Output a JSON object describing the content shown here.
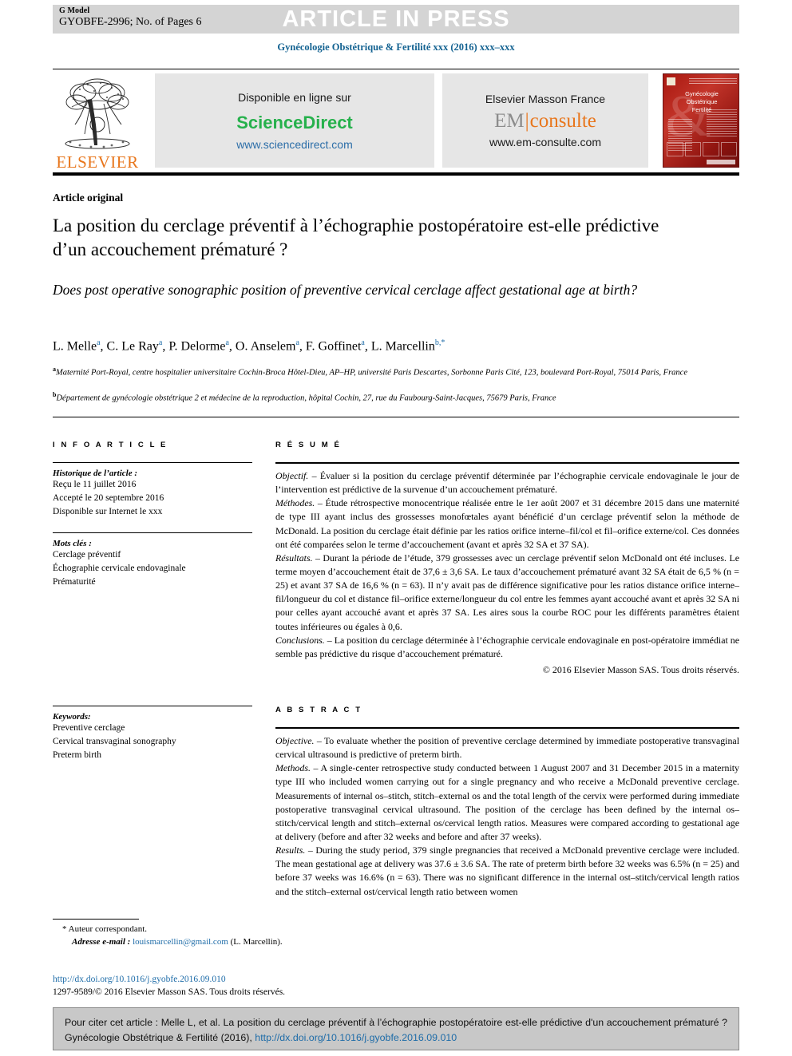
{
  "banner": {
    "g_model": "G Model",
    "pages": "GYOBFE-2996; No. of Pages 6",
    "article_in_press": "ARTICLE IN PRESS"
  },
  "journal": {
    "citation_line": "Gynécologie Obstétrique & Fertilité xxx (2016) xxx–xxx"
  },
  "masthead": {
    "publisher_logo": "ELSEVIER",
    "sciencedirect": {
      "available_label": "Disponible en ligne sur",
      "name": "ScienceDirect",
      "url": "www.sciencedirect.com"
    },
    "emconsulte": {
      "publisher_label": "Elsevier Masson France",
      "logo_em": "EM",
      "logo_consulte": "consulte",
      "url": "www.em-consulte.com"
    },
    "cover": {
      "line1": "Gynécologie",
      "line2": "Obstétrique",
      "line3": "Fertilité"
    }
  },
  "article": {
    "type": "Article original",
    "title_fr": "La position du cerclage préventif à l’échographie postopératoire est-elle prédictive d’un accouchement prématuré ?",
    "title_en": "Does post operative sonographic position of preventive cervical cerclage affect gestational age at birth?",
    "affiliation_a": "Maternité Port-Royal, centre hospitalier universitaire Cochin-Broca Hôtel-Dieu, AP–HP, université Paris Descartes, Sorbonne Paris Cité, 123, boulevard Port-Royal, 75014 Paris, France",
    "affiliation_b": "Département de gynécologie obstétrique 2 et médecine de la reproduction, hôpital Cochin, 27, rue du Faubourg-Saint-Jacques, 75679 Paris, France"
  },
  "authors": [
    {
      "name": "L. Melle",
      "marks": "a"
    },
    {
      "name": "C. Le Ray",
      "marks": "a"
    },
    {
      "name": "P. Delorme",
      "marks": "a"
    },
    {
      "name": "O. Anselem",
      "marks": "a"
    },
    {
      "name": "F. Goffinet",
      "marks": "a"
    },
    {
      "name": "L. Marcellin",
      "marks": "b,*"
    }
  ],
  "info_article": {
    "heading": "I N F O   A R T I C L E",
    "history_label": "Historique de l’article :",
    "history": [
      "Reçu le 11 juillet 2016",
      "Accepté le 20 septembre 2016",
      "Disponible sur Internet le xxx"
    ],
    "keywords_label": "Mots clés :",
    "keywords": [
      "Cerclage préventif",
      "Échographie cervicale endovaginale",
      "Prématurité"
    ]
  },
  "keywords_en": {
    "label": "Keywords:",
    "items": [
      "Preventive cerclage",
      "Cervical transvaginal sonography",
      "Preterm birth"
    ]
  },
  "resume": {
    "heading": "R É S U M É",
    "objectif_label": "Objectif.",
    "objectif_text": " – Évaluer si la position du cerclage préventif déterminée par l’échographie cervicale endovaginale le jour de l’intervention est prédictive de la survenue d’un accouchement prématuré.",
    "methodes_label": "Méthodes.",
    "methodes_text": " – Étude rétrospective monocentrique réalisée entre le 1er août 2007 et 31 décembre 2015 dans une maternité de type III ayant inclus des grossesses monofœtales ayant bénéficié d’un cerclage préventif selon la méthode de McDonald. La position du cerclage était définie par les ratios orifice interne–fil/col et fil–orifice externe/col. Ces données ont été comparées selon le terme d’accouchement (avant et après 32 SA et 37 SA).",
    "resultats_label": "Résultats.",
    "resultats_text": " – Durant la période de l’étude, 379 grossesses avec un cerclage préventif selon McDonald ont été incluses. Le terme moyen d’accouchement était de 37,6 ± 3,6 SA. Le taux d’accouchement prématuré avant 32 SA était de 6,5 % (n = 25) et avant 37 SA de 16,6 % (n = 63). Il n’y avait pas de différence significative pour les ratios distance orifice interne–fil/longueur du col et distance fil–orifice externe/longueur du col entre les femmes ayant accouché avant et après 32 SA ni pour celles ayant accouché avant et après 37 SA. Les aires sous la courbe ROC pour les différents paramètres étaient toutes inférieures ou égales à 0,6.",
    "conclusions_label": "Conclusions.",
    "conclusions_text": " – La position du cerclage déterminée à l’échographie cervicale endovaginale en post-opératoire immédiat ne semble pas prédictive du risque d’accouchement prématuré.",
    "copyright": "© 2016 Elsevier Masson SAS. Tous droits réservés."
  },
  "abstract": {
    "heading": "A B S T R A C T",
    "objective_label": "Objective.",
    "objective_text": " – To evaluate whether the position of preventive cerclage determined by immediate postoperative transvaginal cervical ultrasound is predictive of preterm birth.",
    "methods_label": "Methods.",
    "methods_text": " – A single-center retrospective study conducted between 1 August 2007 and 31 December 2015 in a maternity type III who included women carrying out for a single pregnancy and who receive a McDonald preventive cerclage. Measurements of internal os–stitch, stitch–external os and the total length of the cervix were performed during immediate postoperative transvaginal cervical ultrasound. The position of the cerclage has been defined by the internal os–stitch/cervical length and stitch–external os/cervical length ratios. Measures were compared according to gestational age at delivery (before and after 32 weeks and before and after 37 weeks).",
    "results_label": "Results.",
    "results_text": " – During the study period, 379 single pregnancies that received a McDonald preventive cerclage were included. The mean gestational age at delivery was 37.6 ± 3.6 SA. The rate of preterm birth before 32 weeks was 6.5% (n = 25) and before 37 weeks was 16.6% (n = 63). There was no significant difference in the internal ost–stitch/cervical length ratios and the stitch–external ost/cervical length ratio between women"
  },
  "footnote": {
    "star": "*",
    "corresponding": "Auteur correspondant.",
    "email_label": "Adresse e-mail :",
    "email": "louismarcellin@gmail.com",
    "email_suffix": "(L. Marcellin)."
  },
  "footer": {
    "doi": "http://dx.doi.org/10.1016/j.gyobfe.2016.09.010",
    "issn": "1297-9589/© 2016 Elsevier Masson SAS. Tous droits réservés."
  },
  "citation_box": {
    "text": "Pour citer cet article : Melle L, et al. La position du cerclage préventif à l’échographie postopératoire est-elle prédictive d'un accouchement prématuré ? Gynécologie Obstétrique & Fertilité (2016), ",
    "link": "http://dx.doi.org/10.1016/j.gyobfe.2016.09.010"
  },
  "colors": {
    "journal_blue": "#136291",
    "link_blue": "#1E6CA8",
    "elsevier_orange": "#E8761C",
    "sciencedirect_green": "#26B14C",
    "banner_gray": "#d4d4d4",
    "box_gray": "#e6e6e6",
    "cite_gray": "#c8c8c8"
  }
}
